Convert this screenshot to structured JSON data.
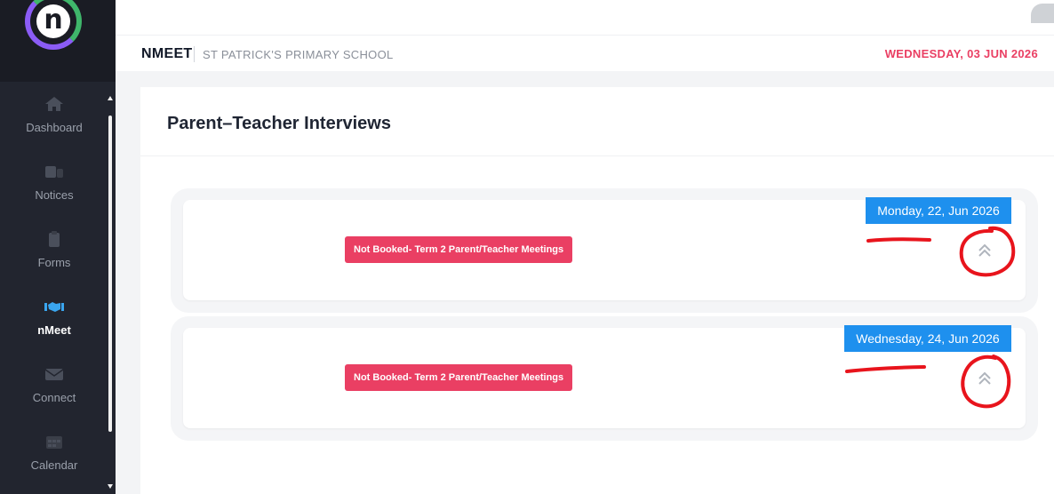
{
  "sidebar": {
    "items": [
      {
        "label": "Dashboard",
        "icon": "home-icon",
        "active": false
      },
      {
        "label": "Notices",
        "icon": "notices-icon",
        "active": false
      },
      {
        "label": "Forms",
        "icon": "forms-icon",
        "active": false
      },
      {
        "label": "nMeet",
        "icon": "handshake-icon",
        "active": true
      },
      {
        "label": "Connect",
        "icon": "envelope-icon",
        "active": false
      },
      {
        "label": "Calendar",
        "icon": "calendar-icon",
        "active": false
      }
    ]
  },
  "header": {
    "brand": "NMEET",
    "school": "ST PATRICK'S PRIMARY SCHOOL",
    "today": "WEDNESDAY, 03 JUN 2026"
  },
  "main": {
    "title": "Parent–Teacher Interviews",
    "interviews": [
      {
        "date": "Monday, 22, Jun 2026",
        "status": "Not Booked- Term 2 Parent/Teacher Meetings",
        "toggle_icon": "chevron-double-up-icon"
      },
      {
        "date": "Wednesday, 24, Jun 2026",
        "status": "Not Booked- Term 2 Parent/Teacher Meetings",
        "toggle_icon": "chevron-double-up-icon"
      }
    ]
  },
  "colors": {
    "accent_red": "#ea3f63",
    "accent_blue": "#1e90ee",
    "annotation_red": "#e8141c",
    "sidebar_bg": "#22252f",
    "active_icon": "#3aa6f0"
  }
}
